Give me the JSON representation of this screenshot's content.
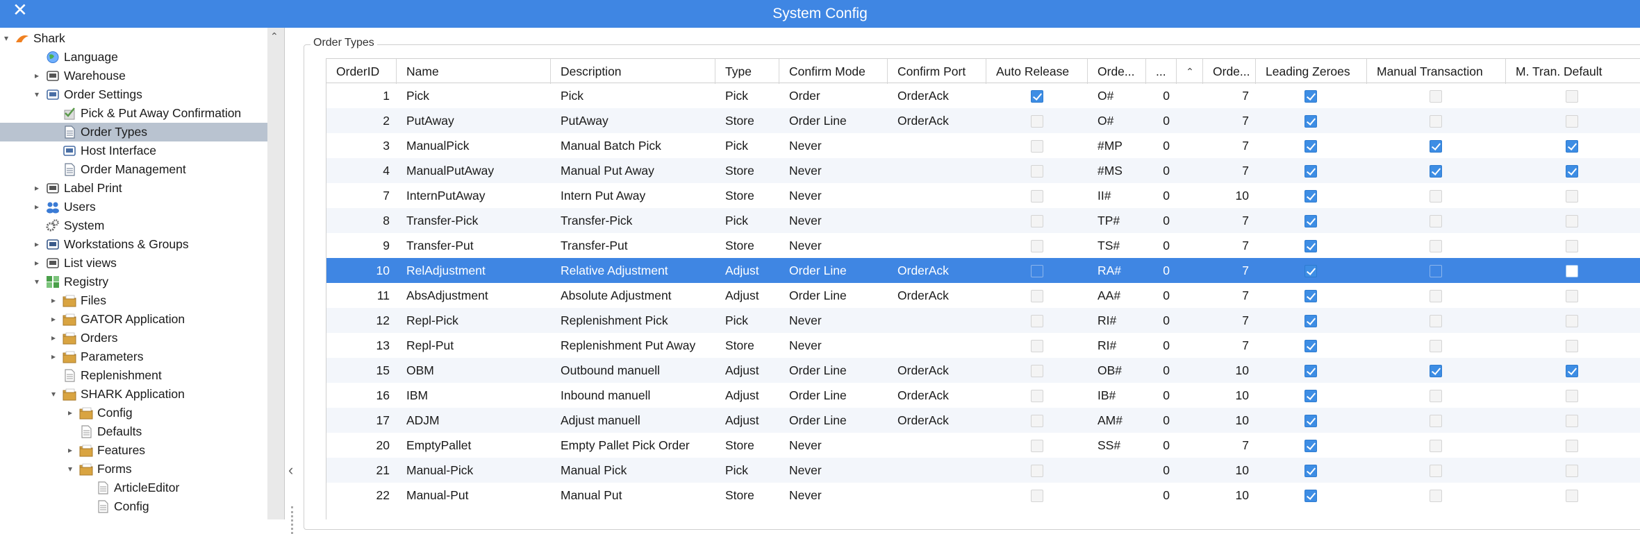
{
  "window": {
    "title": "System Config",
    "close_glyph": "✕"
  },
  "colors": {
    "accent": "#3f86e3",
    "selected_tree": "#b9c3d0",
    "check": "#3d8de4"
  },
  "tree": [
    {
      "label": "Shark",
      "indent": 0,
      "arrow": "▾",
      "icon": "shark-logo-icon",
      "color": "#f08020"
    },
    {
      "label": "Language",
      "indent": 1,
      "arrow": "",
      "icon": "globe-icon",
      "color": "#3a7bd5"
    },
    {
      "label": "Warehouse",
      "indent": 1,
      "arrow": "▸",
      "icon": "truck-icon",
      "color": "#555"
    },
    {
      "label": "Order Settings",
      "indent": 1,
      "arrow": "▾",
      "icon": "document-gear-icon",
      "color": "#4a6fa5"
    },
    {
      "label": "Pick & Put Away Confirmation",
      "indent": 2,
      "arrow": "",
      "icon": "checklist-icon",
      "color": "#5a9a4a"
    },
    {
      "label": "Order Types",
      "indent": 2,
      "arrow": "",
      "icon": "document-icon",
      "color": "#6a7a90",
      "selected": true
    },
    {
      "label": "Host Interface",
      "indent": 2,
      "arrow": "",
      "icon": "document-gear-icon",
      "color": "#4a6fa5"
    },
    {
      "label": "Order Management",
      "indent": 2,
      "arrow": "",
      "icon": "document-icon",
      "color": "#6a7a90"
    },
    {
      "label": "Label Print",
      "indent": 1,
      "arrow": "▸",
      "icon": "printer-icon",
      "color": "#555"
    },
    {
      "label": "Users",
      "indent": 1,
      "arrow": "▸",
      "icon": "users-icon",
      "color": "#3a7bd5"
    },
    {
      "label": "System",
      "indent": 1,
      "arrow": "",
      "icon": "gears-icon",
      "color": "#666"
    },
    {
      "label": "Workstations & Groups",
      "indent": 1,
      "arrow": "▸",
      "icon": "workstation-icon",
      "color": "#3a5a8a"
    },
    {
      "label": "List views",
      "indent": 1,
      "arrow": "▸",
      "icon": "table-icon",
      "color": "#555"
    },
    {
      "label": "Registry",
      "indent": 1,
      "arrow": "▾",
      "icon": "registry-icon",
      "color": "#4aa04a"
    },
    {
      "label": "Files",
      "indent": 2,
      "arrow": "▸",
      "icon": "folder-icon",
      "color": "#d9a441"
    },
    {
      "label": "GATOR Application",
      "indent": 2,
      "arrow": "▸",
      "icon": "folder-icon",
      "color": "#d9a441"
    },
    {
      "label": "Orders",
      "indent": 2,
      "arrow": "▸",
      "icon": "folder-icon",
      "color": "#d9a441"
    },
    {
      "label": "Parameters",
      "indent": 2,
      "arrow": "▸",
      "icon": "folder-icon",
      "color": "#d9a441"
    },
    {
      "label": "Replenishment",
      "indent": 2,
      "arrow": "",
      "icon": "file-icon",
      "color": "#999"
    },
    {
      "label": "SHARK Application",
      "indent": 2,
      "arrow": "▾",
      "icon": "folder-icon",
      "color": "#d9a441"
    },
    {
      "label": "Config",
      "indent": 3,
      "arrow": "▸",
      "icon": "folder-icon",
      "color": "#d9a441"
    },
    {
      "label": "Defaults",
      "indent": 3,
      "arrow": "",
      "icon": "file-icon",
      "color": "#999"
    },
    {
      "label": "Features",
      "indent": 3,
      "arrow": "▸",
      "icon": "folder-icon",
      "color": "#d9a441"
    },
    {
      "label": "Forms",
      "indent": 3,
      "arrow": "▾",
      "icon": "folder-icon",
      "color": "#d9a441"
    },
    {
      "label": "ArticleEditor",
      "indent": 4,
      "arrow": "",
      "icon": "file-icon",
      "color": "#999"
    },
    {
      "label": "Config",
      "indent": 4,
      "arrow": "",
      "icon": "file-icon",
      "color": "#999"
    }
  ],
  "group_title": "Order Types",
  "columns": [
    "OrderID",
    "Name",
    "Description",
    "Type",
    "Confirm Mode",
    "Confirm Port",
    "Auto Release",
    "Orde...",
    "...",
    "",
    "Orde...",
    "Leading Zeroes",
    "Manual Transaction",
    "M. Tran. Default"
  ],
  "sort_indicator": "⌃",
  "rows": [
    {
      "id": "1",
      "name": "Pick",
      "desc": "Pick",
      "type": "Pick",
      "mode": "Order",
      "port": "OrderAck",
      "auto": true,
      "prefix": "O#",
      "n1": "0",
      "n2": "7",
      "lz": true,
      "mt": false,
      "mtd": false
    },
    {
      "id": "2",
      "name": "PutAway",
      "desc": "PutAway",
      "type": "Store",
      "mode": "Order Line",
      "port": "OrderAck",
      "auto": false,
      "prefix": "O#",
      "n1": "0",
      "n2": "7",
      "lz": true,
      "mt": false,
      "mtd": false
    },
    {
      "id": "3",
      "name": "ManualPick",
      "desc": "Manual Batch Pick",
      "type": "Pick",
      "mode": "Never",
      "port": "",
      "auto": false,
      "prefix": "#MP",
      "n1": "0",
      "n2": "7",
      "lz": true,
      "mt": true,
      "mtd": true
    },
    {
      "id": "4",
      "name": "ManualPutAway",
      "desc": "Manual Put Away",
      "type": "Store",
      "mode": "Never",
      "port": "",
      "auto": false,
      "prefix": "#MS",
      "n1": "0",
      "n2": "7",
      "lz": true,
      "mt": true,
      "mtd": true
    },
    {
      "id": "7",
      "name": "InternPutAway",
      "desc": "Intern Put Away",
      "type": "Store",
      "mode": "Never",
      "port": "",
      "auto": false,
      "prefix": "II#",
      "n1": "0",
      "n2": "10",
      "lz": true,
      "mt": false,
      "mtd": false
    },
    {
      "id": "8",
      "name": "Transfer-Pick",
      "desc": "Transfer-Pick",
      "type": "Pick",
      "mode": "Never",
      "port": "",
      "auto": false,
      "prefix": "TP#",
      "n1": "0",
      "n2": "7",
      "lz": true,
      "mt": false,
      "mtd": false
    },
    {
      "id": "9",
      "name": "Transfer-Put",
      "desc": "Transfer-Put",
      "type": "Store",
      "mode": "Never",
      "port": "",
      "auto": false,
      "prefix": "TS#",
      "n1": "0",
      "n2": "7",
      "lz": true,
      "mt": false,
      "mtd": false
    },
    {
      "id": "10",
      "name": "RelAdjustment",
      "desc": "Relative Adjustment",
      "type": "Adjust",
      "mode": "Order Line",
      "port": "OrderAck",
      "auto": false,
      "prefix": "RA#",
      "n1": "0",
      "n2": "7",
      "lz": true,
      "mt": false,
      "mtd": false,
      "selected": true
    },
    {
      "id": "11",
      "name": "AbsAdjustment",
      "desc": "Absolute Adjustment",
      "type": "Adjust",
      "mode": "Order Line",
      "port": "OrderAck",
      "auto": false,
      "prefix": "AA#",
      "n1": "0",
      "n2": "7",
      "lz": true,
      "mt": false,
      "mtd": false
    },
    {
      "id": "12",
      "name": "Repl-Pick",
      "desc": "Replenishment Pick",
      "type": "Pick",
      "mode": "Never",
      "port": "",
      "auto": false,
      "prefix": "RI#",
      "n1": "0",
      "n2": "7",
      "lz": true,
      "mt": false,
      "mtd": false
    },
    {
      "id": "13",
      "name": "Repl-Put",
      "desc": "Replenishment Put Away",
      "type": "Store",
      "mode": "Never",
      "port": "",
      "auto": false,
      "prefix": "RI#",
      "n1": "0",
      "n2": "7",
      "lz": true,
      "mt": false,
      "mtd": false
    },
    {
      "id": "15",
      "name": "OBM",
      "desc": "Outbound manuell",
      "type": "Adjust",
      "mode": "Order Line",
      "port": "OrderAck",
      "auto": false,
      "prefix": "OB#",
      "n1": "0",
      "n2": "10",
      "lz": true,
      "mt": true,
      "mtd": true
    },
    {
      "id": "16",
      "name": "IBM",
      "desc": "Inbound manuell",
      "type": "Adjust",
      "mode": "Order Line",
      "port": "OrderAck",
      "auto": false,
      "prefix": "IB#",
      "n1": "0",
      "n2": "10",
      "lz": true,
      "mt": false,
      "mtd": false
    },
    {
      "id": "17",
      "name": "ADJM",
      "desc": "Adjust manuell",
      "type": "Adjust",
      "mode": "Order Line",
      "port": "OrderAck",
      "auto": false,
      "prefix": "AM#",
      "n1": "0",
      "n2": "10",
      "lz": true,
      "mt": false,
      "mtd": false
    },
    {
      "id": "20",
      "name": "EmptyPallet",
      "desc": "Empty Pallet Pick Order",
      "type": "Store",
      "mode": "Never",
      "port": "",
      "auto": false,
      "prefix": "SS#",
      "n1": "0",
      "n2": "7",
      "lz": true,
      "mt": false,
      "mtd": false
    },
    {
      "id": "21",
      "name": "Manual-Pick",
      "desc": "Manual Pick",
      "type": "Pick",
      "mode": "Never",
      "port": "",
      "auto": false,
      "prefix": "",
      "n1": "0",
      "n2": "10",
      "lz": true,
      "mt": false,
      "mtd": false
    },
    {
      "id": "22",
      "name": "Manual-Put",
      "desc": "Manual Put",
      "type": "Store",
      "mode": "Never",
      "port": "",
      "auto": false,
      "prefix": "",
      "n1": "0",
      "n2": "10",
      "lz": true,
      "mt": false,
      "mtd": false
    }
  ]
}
